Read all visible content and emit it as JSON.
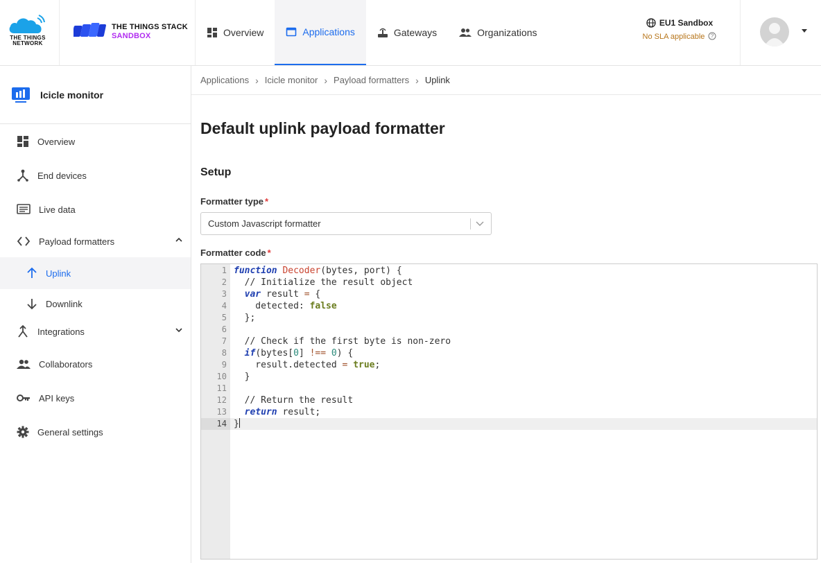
{
  "header": {
    "ttn_logo_line1": "THE THINGS",
    "ttn_logo_line2": "NETWORK",
    "stack_title": "THE THINGS STACK",
    "stack_subtitle": "SANDBOX",
    "nav": [
      {
        "label": "Overview"
      },
      {
        "label": "Applications"
      },
      {
        "label": "Gateways"
      },
      {
        "label": "Organizations"
      }
    ],
    "cluster_name": "EU1 Sandbox",
    "cluster_sla": "No SLA applicable"
  },
  "sidebar": {
    "app_name": "Icicle monitor",
    "items": [
      {
        "label": "Overview"
      },
      {
        "label": "End devices"
      },
      {
        "label": "Live data"
      },
      {
        "label": "Payload formatters"
      },
      {
        "label": "Uplink"
      },
      {
        "label": "Downlink"
      },
      {
        "label": "Integrations"
      },
      {
        "label": "Collaborators"
      },
      {
        "label": "API keys"
      },
      {
        "label": "General settings"
      }
    ]
  },
  "breadcrumb": [
    "Applications",
    "Icicle monitor",
    "Payload formatters",
    "Uplink"
  ],
  "main": {
    "title": "Default uplink payload formatter",
    "section": "Setup",
    "formatter_type_label": "Formatter type",
    "formatter_type_value": "Custom Javascript formatter",
    "formatter_code_label": "Formatter code",
    "required_mark": "*"
  },
  "colors": {
    "accent": "#1c6ced",
    "sandbox": "#b12cf0",
    "sla": "#b7751a"
  },
  "code_lines": [
    "function Decoder(bytes, port) {",
    "  // Initialize the result object",
    "  var result = {",
    "    detected: false",
    "  };",
    "",
    "  // Check if the first byte is non-zero",
    "  if(bytes[0] !== 0) {",
    "    result.detected = true;",
    "  }",
    "",
    "  // Return the result",
    "  return result;",
    "}"
  ],
  "line_numbers": [
    "1",
    "2",
    "3",
    "4",
    "5",
    "6",
    "7",
    "8",
    "9",
    "10",
    "11",
    "12",
    "13",
    "14"
  ]
}
